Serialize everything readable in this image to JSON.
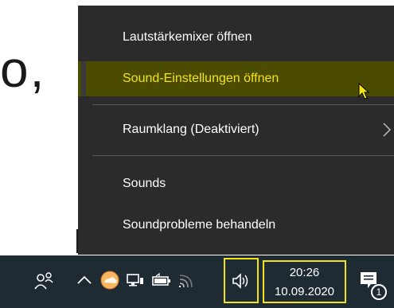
{
  "background_text": {
    "top": "o,",
    "bottom": ""
  },
  "menu": {
    "items": [
      {
        "label": "Lautstärkemixer öffnen"
      },
      {
        "label": "Sound-Einstellungen öffnen",
        "highlighted": true
      },
      {
        "label": "Raumklang (Deaktiviert)",
        "has_submenu": true
      },
      {
        "label": "Sounds"
      },
      {
        "label": "Soundprobleme behandeln"
      }
    ]
  },
  "taskbar": {
    "clock_time": "20:26",
    "clock_date": "10.09.2020",
    "notification_count": "1"
  },
  "colors": {
    "menu_bg": "#2b2b2b",
    "highlight_bg": "#4c4c00",
    "highlight_text": "#f5e31a",
    "taskbar_bg": "#1f2b33",
    "focus_outline": "#f5e31a"
  },
  "icons": [
    "people-icon",
    "chevron-up-icon",
    "onedrive-icon",
    "network-icon",
    "battery-icon",
    "wifi-icon",
    "speaker-icon",
    "chevron-right-icon",
    "notification-icon",
    "mouse-pointer-icon"
  ]
}
